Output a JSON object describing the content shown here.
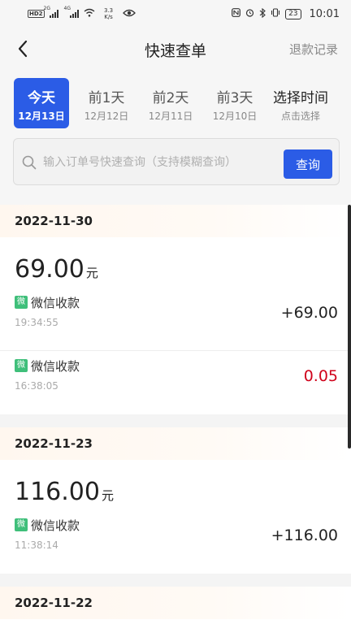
{
  "status_bar": {
    "hd_label": "HD",
    "hd_num": "2",
    "net1": "2G",
    "net2": "4G",
    "speed": "3.3 K/s",
    "battery": "23",
    "time": "10:01"
  },
  "header": {
    "title": "快速查单",
    "refund_link": "退款记录"
  },
  "tabs": [
    {
      "label": "今天",
      "date": "12月13日"
    },
    {
      "label": "前1天",
      "date": "12月12日"
    },
    {
      "label": "前2天",
      "date": "12月11日"
    },
    {
      "label": "前3天",
      "date": "12月10日"
    },
    {
      "label": "选择时间",
      "date": "点击选择"
    }
  ],
  "search": {
    "placeholder": "输入订单号快速查询（支持模糊查询）",
    "button": "查询"
  },
  "groups": [
    {
      "date": "2022-11-30",
      "total": "69.00",
      "unit": "元",
      "items": [
        {
          "badge": "微",
          "name": "微信收款",
          "time": "19:34:55",
          "amount": "+69.00"
        },
        {
          "badge": "微",
          "name": "微信收款",
          "time": "16:38:05",
          "amount": "0.05"
        }
      ]
    },
    {
      "date": "2022-11-23",
      "total": "116.00",
      "unit": "元",
      "items": [
        {
          "badge": "微",
          "name": "微信收款",
          "time": "11:38:14",
          "amount": "+116.00"
        }
      ]
    },
    {
      "date": "2022-11-22"
    }
  ],
  "colors": {
    "accent": "#2b5ce6",
    "wechat_green": "#3fbf7a",
    "negative_red": "#d0021b"
  }
}
